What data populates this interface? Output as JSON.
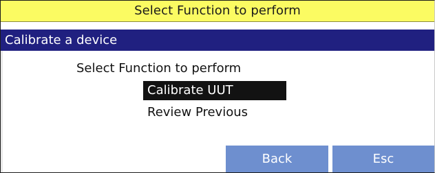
{
  "window": {
    "title": "Select Function to perform"
  },
  "section": {
    "label": "Calibrate a device"
  },
  "main": {
    "prompt": "Select Function to perform",
    "menu": [
      {
        "label": "Calibrate UUT",
        "selected": true
      },
      {
        "label": "Review Previous",
        "selected": false
      }
    ]
  },
  "footer": {
    "back_label": "Back",
    "esc_label": "Esc"
  },
  "colors": {
    "title_bar": "#fbfb62",
    "section_bar": "#202080",
    "selected_item": "#121212",
    "button": "#6e8fcf"
  }
}
